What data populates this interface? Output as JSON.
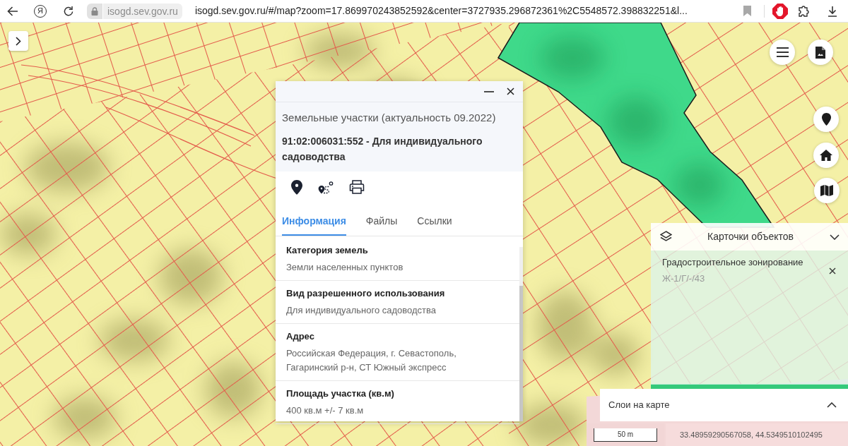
{
  "browser": {
    "home_button": "Я",
    "domain": "isogd.sev.gov.ru",
    "url": "isogd.sev.gov.ru/#/map?zoom=17.869970243852592&center=3727935.296872361%2C5548572.398832251&l..."
  },
  "popup": {
    "layer_title": "Земельные участки (актуальность 09.2022)",
    "object_title": "91:02:006031:552 - Для индивидуального садоводства",
    "tabs": [
      {
        "label": "Информация",
        "selected": true
      },
      {
        "label": "Файлы",
        "selected": false
      },
      {
        "label": "Ссылки",
        "selected": false
      }
    ],
    "fields": [
      {
        "label": "Категория земель",
        "value": "Земли населенных пунктов"
      },
      {
        "label": "Вид разрешенного использования",
        "value": "Для индивидуального садоводства"
      },
      {
        "label": "Адрес",
        "value": "Российская Федерация, г. Севастополь, Гагаринский р-н, СТ Южный экспресс"
      },
      {
        "label": "Площадь участка (кв.м)",
        "value": "400 кв.м +/- 7 кв.м"
      }
    ]
  },
  "object_cards": {
    "title": "Карточки объектов",
    "expanded": true,
    "items": [
      {
        "title": "Градостроительное зонирование",
        "value": "Ж-1/Г/-/43"
      }
    ]
  },
  "layers_panel": {
    "title": "Слои на карте",
    "expanded": false
  },
  "scale_label": "50 m",
  "coordinates": "33.48959290567058, 44.5349510102495"
}
